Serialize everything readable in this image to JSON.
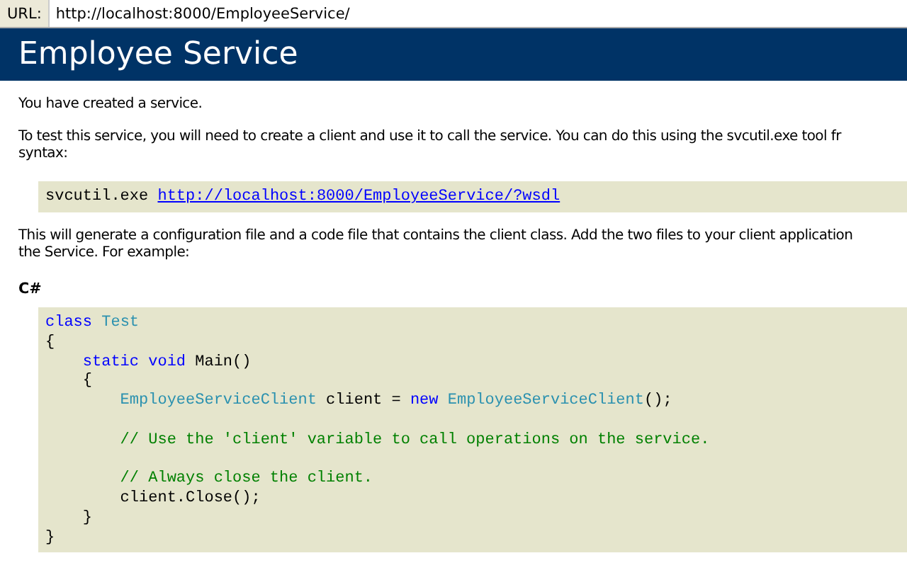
{
  "address_bar": {
    "label": "URL:",
    "value": "http://localhost:8000/EmployeeService/"
  },
  "header": {
    "title": "Employee Service"
  },
  "intro": "You have created a service.",
  "instructions": {
    "lines": [
      "To test this service, you will need to create a client and use it to call the service. You can do this using the svcutil.exe tool fr",
      "syntax:"
    ]
  },
  "command": {
    "program": "svcutil.exe",
    "link": "http://localhost:8000/EmployeeService/?wsdl"
  },
  "explanation": {
    "lines": [
      "This will generate a configuration file and a code file that contains the client class. Add the two files to your client application",
      "the Service. For example:"
    ]
  },
  "language": "C#",
  "code": {
    "lines": [
      {
        "kind": "code",
        "tokens": [
          {
            "kind": "keyword",
            "text": "class"
          },
          {
            "kind": "type",
            "text": " Test"
          }
        ]
      },
      {
        "kind": "code",
        "tokens": [
          {
            "kind": "plain",
            "text": "{"
          }
        ]
      },
      {
        "kind": "code",
        "tokens": [
          {
            "kind": "keyword",
            "text": "    static void"
          },
          {
            "kind": "plain",
            "text": " Main()"
          }
        ]
      },
      {
        "kind": "code",
        "tokens": [
          {
            "kind": "plain",
            "text": "    {"
          }
        ]
      },
      {
        "kind": "code",
        "tokens": [
          {
            "kind": "type",
            "text": "        EmployeeServiceClient"
          },
          {
            "kind": "plain",
            "text": " client = "
          },
          {
            "kind": "keyword",
            "text": "new"
          },
          {
            "kind": "type",
            "text": " EmployeeServiceClient"
          },
          {
            "kind": "plain",
            "text": "();"
          }
        ]
      },
      {
        "kind": "blank"
      },
      {
        "kind": "code",
        "tokens": [
          {
            "kind": "comment",
            "text": "        // Use the 'client' variable to call operations on the service."
          }
        ]
      },
      {
        "kind": "blank"
      },
      {
        "kind": "code",
        "tokens": [
          {
            "kind": "comment",
            "text": "        // Always close the client."
          }
        ]
      },
      {
        "kind": "code",
        "tokens": [
          {
            "kind": "plain",
            "text": "        client.Close();"
          }
        ]
      },
      {
        "kind": "code",
        "tokens": [
          {
            "kind": "plain",
            "text": "    }"
          }
        ]
      },
      {
        "kind": "code",
        "tokens": [
          {
            "kind": "plain",
            "text": "}"
          }
        ]
      }
    ]
  }
}
